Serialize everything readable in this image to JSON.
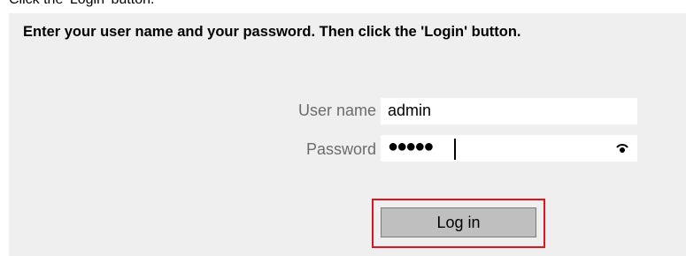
{
  "top_fragment": "Click the 'Login' button.",
  "instruction": "Enter your user name and your password. Then click the 'Login' button.",
  "form": {
    "username_label": "User name",
    "username_value": "admin",
    "password_label": "Password",
    "password_mask": "●●●●●",
    "password_length": 5,
    "show_password_icon": "eye-icon"
  },
  "login_button": {
    "label": "Log in"
  },
  "colors": {
    "panel_bg": "#efefef",
    "label_text": "#6b6b6b",
    "button_bg": "#bfbfbf",
    "highlight": "#e0141e"
  }
}
